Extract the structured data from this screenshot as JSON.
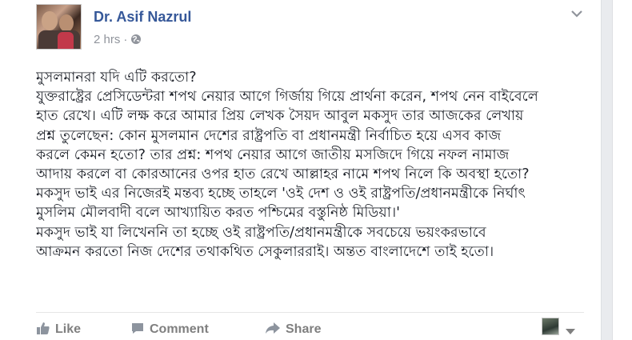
{
  "post": {
    "author": "Dr. Asif Nazrul",
    "time": "2 hrs",
    "separator": "·",
    "privacy_icon": "globe-icon",
    "options_icon": "chevron-down-icon",
    "lines": [
      "মুসলমানরা যদি এটি করতো?",
      "যুক্তরাষ্ট্রের প্রেসিডেন্টরা শপথ নেয়ার আগে গির্জায় গিয়ে প্রার্থনা করেন, শপথ নেন বাইবেলে",
      "হাত রেখে। এটি লক্ষ করে আমার প্রিয় লেখক সৈয়দ আবুল মকসুদ তার আজকের লেখায়",
      "প্রশ্ন তুলেছেন: কোন মুসলমান দেশের রাষ্ট্রপতি বা প্রধানমন্ত্রী নির্বাচিত হয়ে এসব কাজ",
      "করলে কেমন হতো? তার প্রশ্ন: শপথ নেয়ার আগে জাতীয় মসজিদে গিয়ে নফল নামাজ",
      "আদায় করলে বা কোরআনের ওপর হাত রেখে আল্লাহর নামে শপথ নিলে কি অবস্থা হতো?",
      "মকসুদ ভাই এর নিজেরই মন্তব্য হচ্ছে তাহলে 'ওই দেশ ও ওই রাষ্ট্রপতি/প্রধানমন্ত্রীকে নির্ঘাৎ",
      "মুসলিম মৌলবাদী বলে আখ্যায়িত করত পশ্চিমের বস্তুনিষ্ঠ মিডিয়া।'",
      "মকসুদ ভাই যা লিখেননি তা হচ্ছে ওই রাষ্ট্রপতি/প্রধানমন্ত্রীকে সবচেয়ে ভয়ংকরভাবে",
      "আক্রমন করতো নিজ দেশের তথাকথিত সেকুলাররাই। অন্তত বাংলাদেশে তাই হতো।"
    ]
  },
  "actions": {
    "like": "Like",
    "comment": "Comment",
    "share": "Share",
    "like_icon": "thumbs-up-icon",
    "comment_icon": "comment-icon",
    "share_icon": "share-arrow-icon"
  },
  "colors": {
    "author": "#365899",
    "meta": "#90949c",
    "text": "#1d2129",
    "action": "#7f7f7f"
  }
}
